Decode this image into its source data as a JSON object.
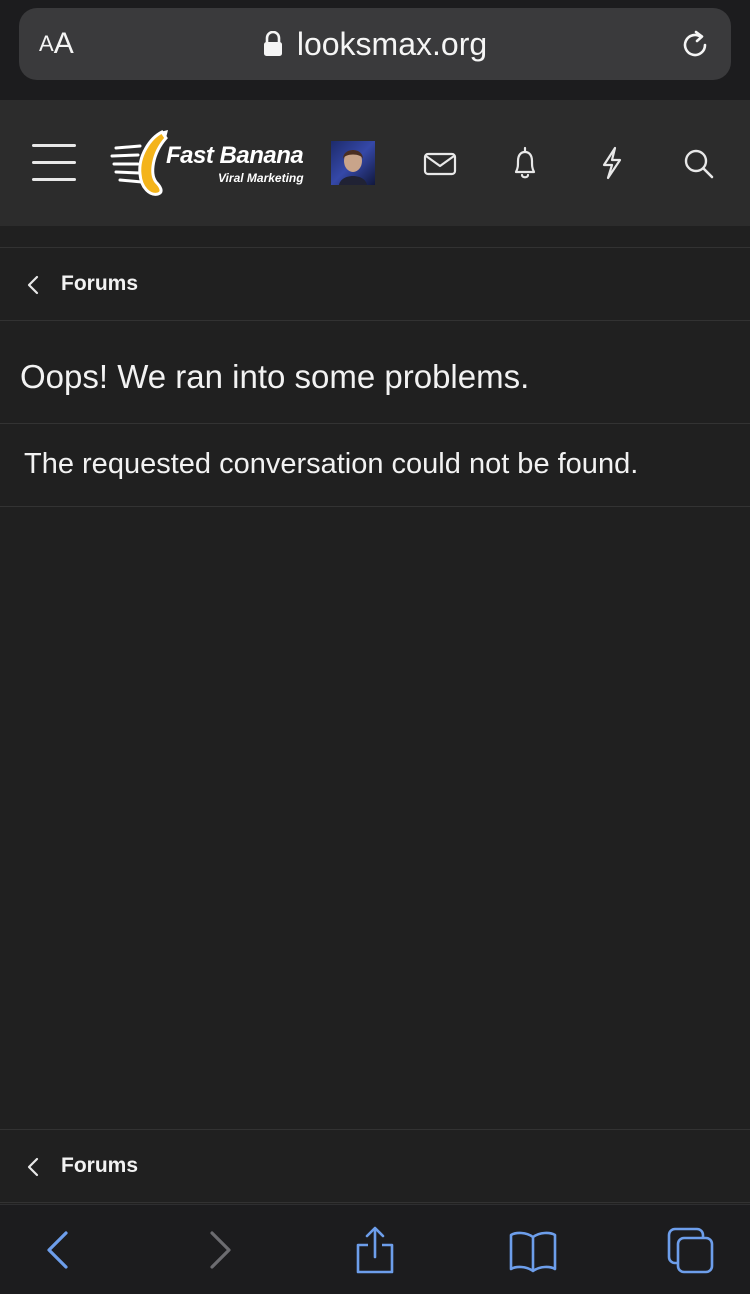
{
  "browser": {
    "text_size_small": "A",
    "text_size_large": "A",
    "url": "looksmax.org",
    "accent_color": "#6d9eeb"
  },
  "header": {
    "logo_title": "Fast Banana",
    "logo_subtitle": "Viral Marketing",
    "icons": [
      "menu-icon",
      "mail-icon",
      "bell-icon",
      "bolt-icon",
      "search-icon"
    ]
  },
  "breadcrumb_top": {
    "label": "Forums"
  },
  "main": {
    "title": "Oops! We ran into some problems.",
    "message": "The requested conversation could not be found."
  },
  "breadcrumb_bottom": {
    "label": "Forums"
  },
  "toolbar": {
    "icons": [
      "back-icon",
      "forward-icon",
      "share-icon",
      "bookmarks-icon",
      "tabs-icon"
    ]
  }
}
